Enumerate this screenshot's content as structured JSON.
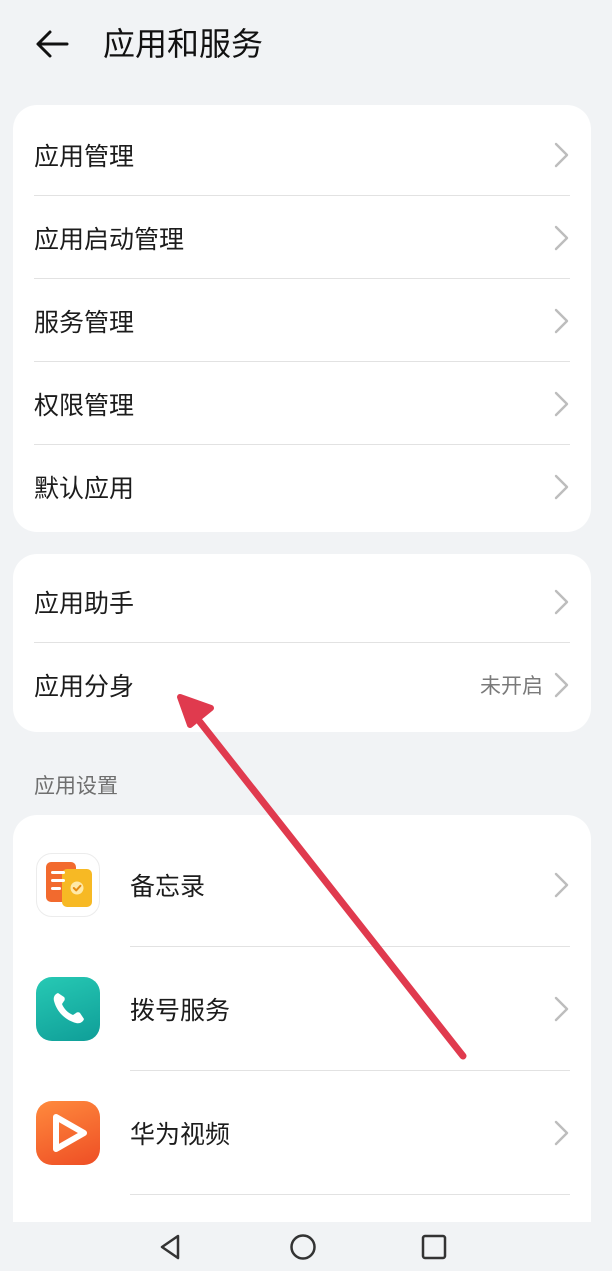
{
  "header": {
    "title": "应用和服务",
    "back_icon": "arrow-left-icon"
  },
  "group1": {
    "items": [
      {
        "label": "应用管理"
      },
      {
        "label": "应用启动管理"
      },
      {
        "label": "服务管理"
      },
      {
        "label": "权限管理"
      },
      {
        "label": "默认应用"
      }
    ]
  },
  "group2": {
    "items": [
      {
        "label": "应用助手",
        "value": ""
      },
      {
        "label": "应用分身",
        "value": "未开启"
      }
    ]
  },
  "app_settings": {
    "section_title": "应用设置",
    "apps": [
      {
        "label": "备忘录",
        "icon": "notepad-icon",
        "color": "#f5a623"
      },
      {
        "label": "拨号服务",
        "icon": "phone-icon",
        "color": "#12b5a6"
      },
      {
        "label": "华为视频",
        "icon": "video-play-icon",
        "color": "#f0622d"
      }
    ]
  },
  "navbar": {
    "back": "nav-back-icon",
    "home": "nav-home-icon",
    "recent": "nav-recent-icon"
  },
  "colors": {
    "background": "#f1f3f5",
    "card": "#ffffff",
    "annotation_arrow": "#e03a4e"
  }
}
